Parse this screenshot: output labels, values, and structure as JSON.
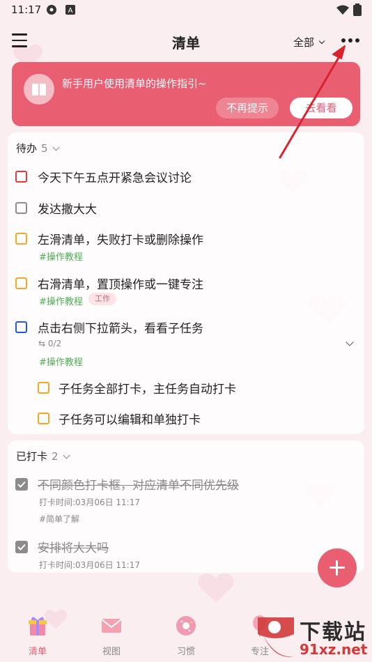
{
  "status_bar": {
    "time": "11:17"
  },
  "header": {
    "title": "清单",
    "filter_label": "全部"
  },
  "banner": {
    "text": "新手用户使用清单的操作指引~",
    "dismiss_label": "不再提示",
    "view_label": "去看看"
  },
  "todo": {
    "title": "待办",
    "count": "5",
    "tasks": [
      {
        "title": "今天下午五点开紧急会议讨论",
        "color": "#e53935"
      },
      {
        "title": "发达撒大大",
        "color": "#8c8c8c"
      },
      {
        "title": "左滑清单，失败打卡或删除操作",
        "color": "#f5a623",
        "tag": "#操作教程"
      },
      {
        "title": "右滑清单，置顶操作或一键专注",
        "color": "#f5a623",
        "tag": "#操作教程",
        "pill": "工作"
      },
      {
        "title": "点击右侧下拉箭头，看看子任务",
        "color": "#1e5bd8",
        "subtasks": "0/2",
        "tag": "#操作教程"
      }
    ],
    "subtasks": [
      {
        "title": "子任务全部打卡，主任务自动打卡",
        "color": "#f5a623"
      },
      {
        "title": "子任务可以编辑和单独打卡",
        "color": "#f5a623"
      }
    ]
  },
  "done": {
    "title": "已打卡",
    "count": "2",
    "tasks": [
      {
        "title": "不同颜色打卡框，对应清单不同优先级",
        "time": "打卡时间:03月06日 11:17",
        "tag": "#简单了解"
      },
      {
        "title": "安排将大大吗",
        "time": "打卡时间:03月06日 11:17"
      }
    ]
  },
  "bottom_nav": {
    "items": [
      {
        "label": "清单",
        "icon": "gift-icon",
        "active": true
      },
      {
        "label": "视图",
        "icon": "envelope-icon",
        "active": false
      },
      {
        "label": "习惯",
        "icon": "donut-icon",
        "active": false
      },
      {
        "label": "专注",
        "icon": "balloon-icon",
        "active": false
      }
    ]
  },
  "watermark": {
    "line1": "下载站",
    "line2": "91xz.net"
  },
  "colors": {
    "accent": "#ea5e72",
    "annotation_arrow": "#d9232f"
  }
}
